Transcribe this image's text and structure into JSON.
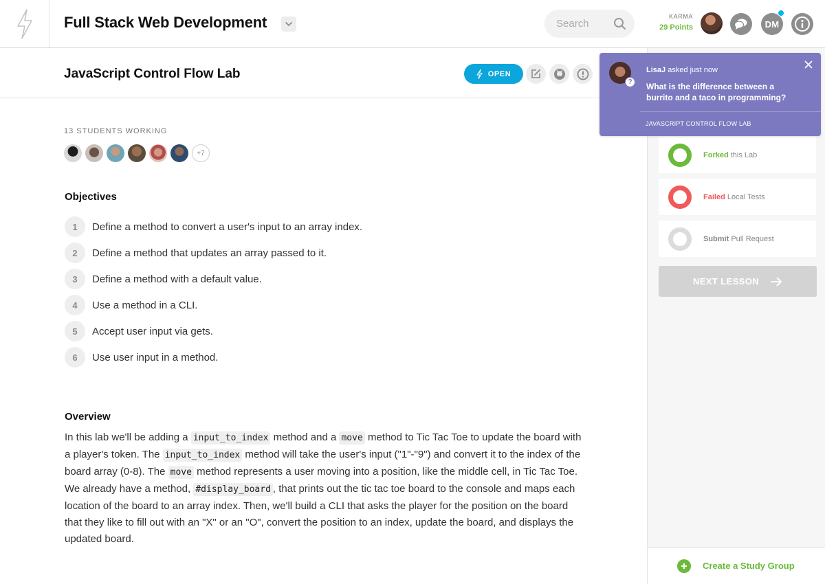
{
  "header": {
    "course_title": "Full Stack Web Development",
    "search_placeholder": "Search",
    "karma_label": "KARMA",
    "karma_points": "29 Points",
    "user_initials": "DM"
  },
  "lesson": {
    "title": "JavaScript Control Flow Lab",
    "open_label": "OPEN"
  },
  "students": {
    "label": "13 STUDENTS WORKING",
    "more": "+7"
  },
  "objectives": {
    "title": "Objectives",
    "items": [
      {
        "num": "1",
        "text": "Define a method to convert a user's input to an array index."
      },
      {
        "num": "2",
        "text": "Define a method that updates an array passed to it."
      },
      {
        "num": "3",
        "text": "Define a method with a default value."
      },
      {
        "num": "4",
        "text": "Use a method in a CLI."
      },
      {
        "num": "5",
        "text": "Accept user input via gets."
      },
      {
        "num": "6",
        "text": "Use user input in a method."
      }
    ]
  },
  "overview": {
    "title": "Overview",
    "t1": "In this lab we'll be adding a ",
    "c1": "input_to_index",
    "t2": " method and a ",
    "c2": "move",
    "t3": " method to Tic Tac Toe to update the board with a player's token. The ",
    "c3": "input_to_index",
    "t4": " method will take the user's input (\"1\"-\"9\") and convert it to the index of the board array (0-8). The ",
    "c4": "move",
    "t5": " method represents a user moving into a position, like the middle cell, in Tic Tac Toe. We already have a method, ",
    "c5": "#display_board",
    "t6": ", that prints out the tic tac toe board to the console and maps each location of the board to an array index. Then, we'll build a CLI that asks the player for the position on the board that they like to fill out with an \"X\" or an \"O\", convert the position to an index, update the board, and displays the updated board."
  },
  "progress": [
    {
      "status": "Forked",
      "rest": " this Lab",
      "color": "#6bba3b"
    },
    {
      "status": "Failed",
      "rest": " Local Tests",
      "color": "#f15a5a"
    },
    {
      "status": "Submit",
      "rest": " Pull Request",
      "color": "#888888"
    }
  ],
  "next_lesson_label": "NEXT LESSON",
  "study_group_label": "Create a Study Group",
  "notification": {
    "user": "LisaJ",
    "time": " asked just now",
    "message": "What is the difference between a burrito and a taco in programming?",
    "lesson": "JAVASCRIPT CONTROL FLOW LAB"
  },
  "colors": {
    "accent_blue": "#0aa6dc",
    "green": "#6bba3b",
    "red": "#f15a5a",
    "purple": "#7c79c0"
  }
}
